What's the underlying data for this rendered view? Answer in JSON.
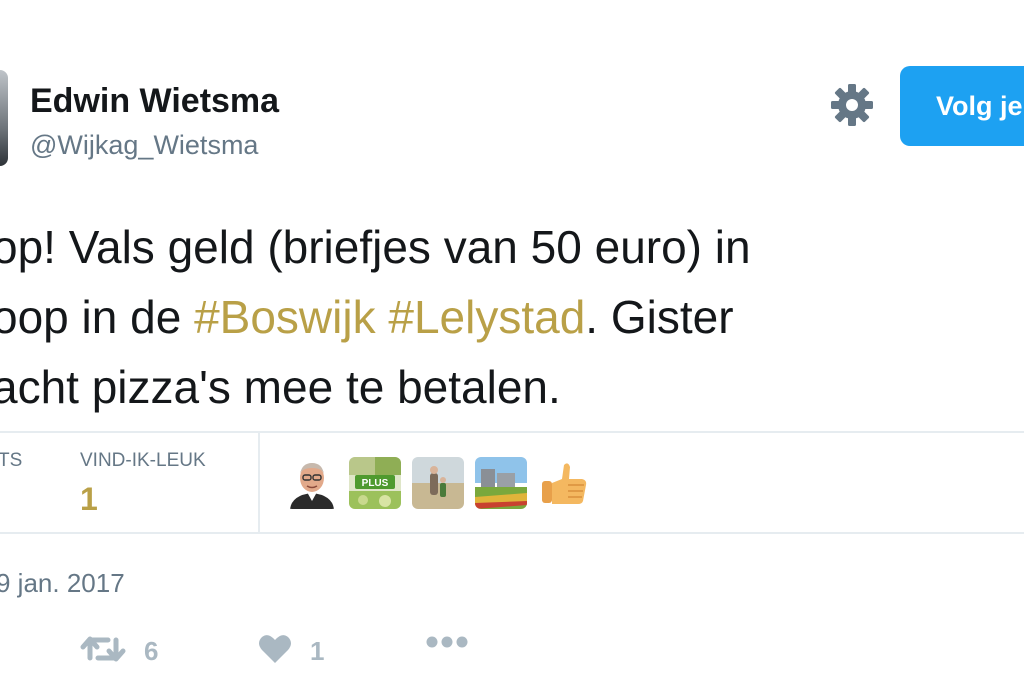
{
  "header": {
    "display_name": "Edwin Wietsma",
    "handle": "@Wijkag_Wietsma",
    "follow_label": "Volg je",
    "gear_icon": "gear-icon"
  },
  "tweet": {
    "line1": "op! Vals geld (briefjes van 50 euro) in",
    "line2_pre": "oop in de ",
    "hashtag1": "#Boswijk",
    "hashtag2": "#Lelystad",
    "line2_post": ". Gister",
    "line3": "acht pizza's mee te betalen."
  },
  "stats": {
    "retweets_label": "TS",
    "likes_label": "VIND-IK-LEUK",
    "likes_value": "1",
    "liker_avatars": [
      "man-avatar",
      "plus-logo-avatar",
      "beach-photo-avatar",
      "field-photo-avatar",
      "thumbs-up-avatar"
    ]
  },
  "timestamp": "9 jan. 2017",
  "actions": {
    "retweet_count": "6",
    "like_count": "1",
    "more_icon": "more-icon"
  },
  "colors": {
    "accent": "#b9a047",
    "follow_button": "#1da1f2",
    "secondary_text": "#657786",
    "icon_gray": "#aab8c2"
  }
}
